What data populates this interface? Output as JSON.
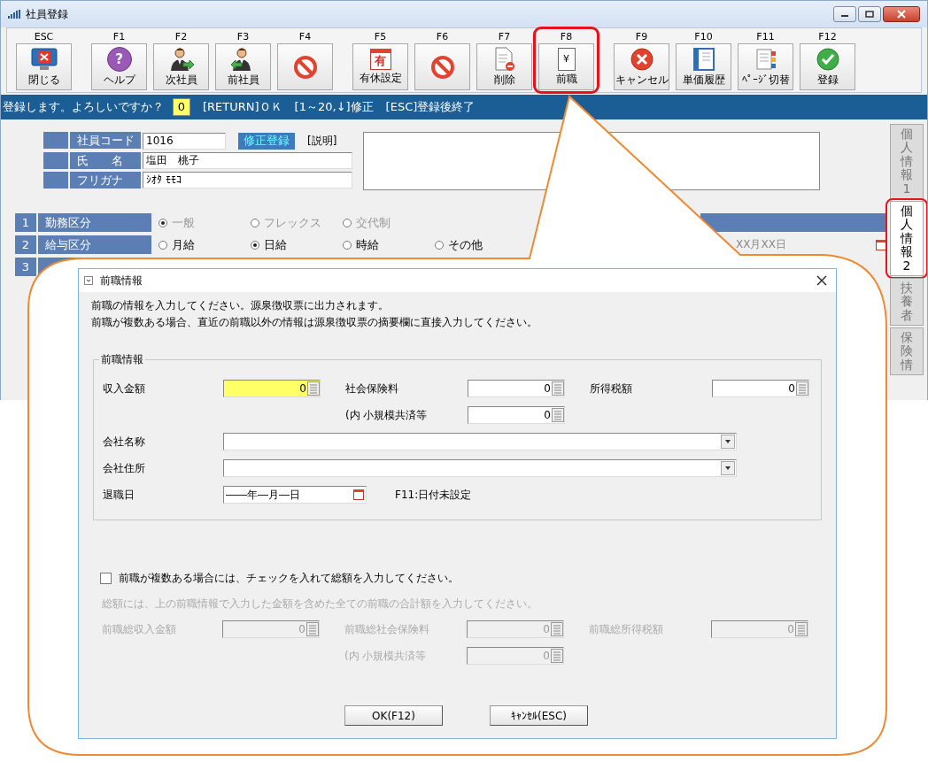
{
  "window": {
    "title": "社員登録"
  },
  "toolbar_groups": [
    [
      {
        "key": "ESC",
        "label": "閉じる",
        "kind": "monitor-x",
        "highlighted": false
      }
    ],
    [
      {
        "key": "F1",
        "label": "ヘルプ",
        "kind": "help",
        "icon_text": "?",
        "highlighted": false
      },
      {
        "key": "F2",
        "label": "次社員",
        "kind": "person-next",
        "highlighted": false
      },
      {
        "key": "F3",
        "label": "前社員",
        "kind": "person-prev",
        "highlighted": false
      },
      {
        "key": "F4",
        "kind": "prohibit",
        "highlighted": false
      }
    ],
    [
      {
        "key": "F5",
        "label": "有休設定",
        "kind": "calendar",
        "icon_text": "有",
        "highlighted": false
      },
      {
        "key": "F6",
        "kind": "prohibit",
        "highlighted": false
      },
      {
        "key": "F7",
        "label": "削除",
        "kind": "doc-minus",
        "highlighted": false
      },
      {
        "key": "F8",
        "label": "前職",
        "kind": "doc-text",
        "icon_text": "¥",
        "highlighted": true
      }
    ],
    [
      {
        "key": "F9",
        "label": "キャンセル",
        "kind": "cancel",
        "highlighted": false
      },
      {
        "key": "F10",
        "label": "単価履歴",
        "kind": "binder",
        "highlighted": false
      },
      {
        "key": "F11",
        "label": "ﾍﾟｰｼﾞ切替",
        "kind": "pages",
        "highlighted": false
      },
      {
        "key": "F12",
        "label": "登録",
        "kind": "check",
        "highlighted": false
      }
    ]
  ],
  "status_bar": {
    "prompt": "登録します。よろしいですか？",
    "value": "0",
    "hints": [
      "[RETURN]ＯＫ",
      "[1～20,↓]修正",
      "[ESC]登録後終了"
    ]
  },
  "employee": {
    "fields": [
      {
        "label": "社員コード",
        "value": "1016"
      },
      {
        "label": "氏　　名",
        "value": "塩田　桃子"
      },
      {
        "label": "フリガナ",
        "value": "ｼｵﾀ ﾓﾓｺ"
      }
    ],
    "edit_button": "修正登録",
    "note_label": "[説明]"
  },
  "sections": [
    {
      "number": "1",
      "label": "勤務区分",
      "kind": "bar",
      "options": [
        {
          "label": "一般",
          "selected": true,
          "disabled": true
        },
        {
          "label": "フレックス",
          "selected": false,
          "disabled": true
        },
        {
          "label": "交代制",
          "selected": false,
          "disabled": true
        }
      ]
    },
    {
      "number": "2",
      "label": "給与区分",
      "kind": "date",
      "date_value": "XX月XX日",
      "options": [
        {
          "label": "月給",
          "selected": false,
          "disabled": false
        },
        {
          "label": "日給",
          "selected": true,
          "disabled": false
        },
        {
          "label": "時給",
          "selected": false,
          "disabled": false
        },
        {
          "label": "その他",
          "selected": false,
          "disabled": false
        }
      ]
    },
    {
      "number": "3"
    }
  ],
  "side_tabs": [
    {
      "label": "個人情報1",
      "selected": false,
      "highlighted": false
    },
    {
      "label": "個人情報2",
      "selected": true,
      "highlighted": true
    },
    {
      "label": "扶養者",
      "selected": false,
      "highlighted": false
    },
    {
      "label": "保険情",
      "selected": false,
      "highlighted": false
    }
  ],
  "dialog": {
    "title": "前職情報",
    "notes": [
      "前職の情報を入力してください。源泉徴収票に出力されます。",
      "前職が複数ある場合、直近の前職以外の情報は源泉徴収票の摘要欄に直接入力してください。"
    ],
    "group": {
      "title": "前職情報",
      "amounts": [
        {
          "label": "収入金額",
          "value": "0",
          "focused": true
        },
        {
          "label": "社会保険料",
          "value": "0",
          "focused": false,
          "sub": {
            "label": "(内 小規模共済等",
            "value": "0"
          }
        },
        {
          "label": "所得税額",
          "value": "0",
          "focused": false
        }
      ],
      "combos": [
        {
          "label": "会社名称"
        },
        {
          "label": "会社住所"
        }
      ],
      "retire_date": {
        "label": "退職日",
        "value": "――年―月―日",
        "hint": "F11:日付未設定"
      }
    },
    "multiple": {
      "label": "前職が複数ある場合には、チェックを入れて総額を入力してください。",
      "checked": false,
      "disabled": true,
      "note": "総額には、上の前職情報で入力した金額を含めた全ての前職の合計額を入力してください。",
      "amounts": [
        {
          "label": "前職総収入金額",
          "value": "0"
        },
        {
          "label": "前職総社会保険料",
          "value": "0",
          "sub": {
            "label": "(内 小規模共済等",
            "value": "0"
          }
        },
        {
          "label": "前職総所得税額",
          "value": "0"
        }
      ]
    },
    "buttons": [
      "OK(F12)",
      "ｷｬﾝｾﾙ(ESC)"
    ]
  }
}
